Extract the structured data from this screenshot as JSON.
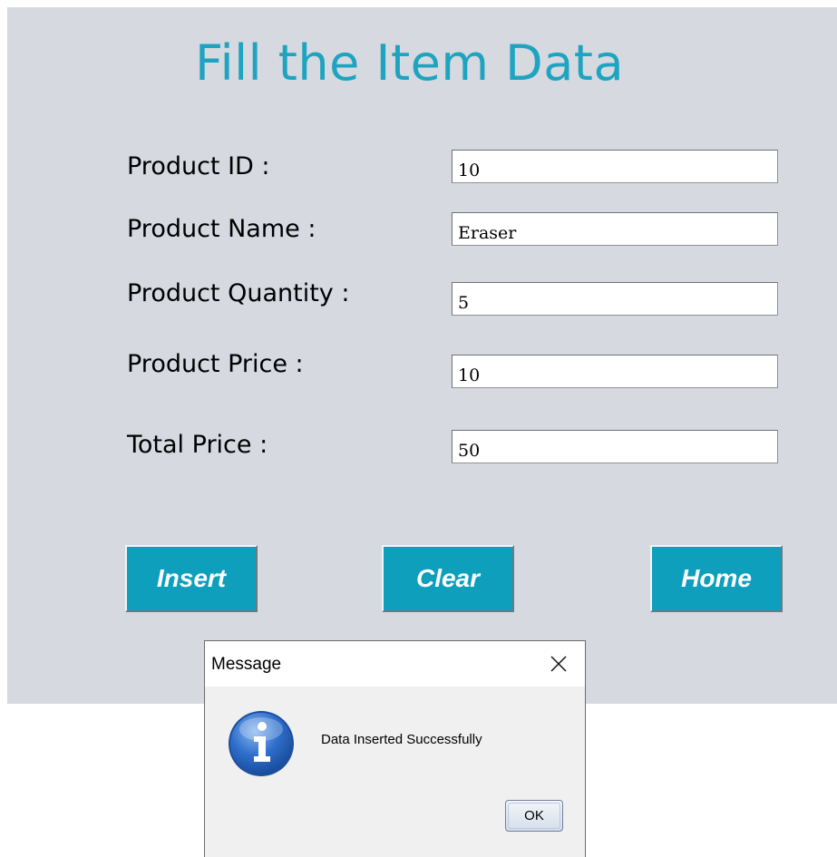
{
  "form": {
    "title": "Fill the Item Data",
    "fields": [
      {
        "label": "Product ID :",
        "value": "10"
      },
      {
        "label": "Product Name :",
        "value": "Eraser"
      },
      {
        "label": "Product Quantity :",
        "value": "5"
      },
      {
        "label": "Product Price :",
        "value": "10"
      },
      {
        "label": "Total Price :",
        "value": "50"
      }
    ],
    "buttons": {
      "insert": "Insert",
      "clear": "Clear",
      "home": "Home"
    }
  },
  "dialog": {
    "title": "Message",
    "message": "Data Inserted Successfully",
    "ok_label": "OK",
    "icon": "info-icon",
    "close_icon": "close-icon"
  },
  "colors": {
    "panel_bg": "#d6d9e0",
    "title": "#1ea4c0",
    "button_bg": "#0e9fbc"
  }
}
